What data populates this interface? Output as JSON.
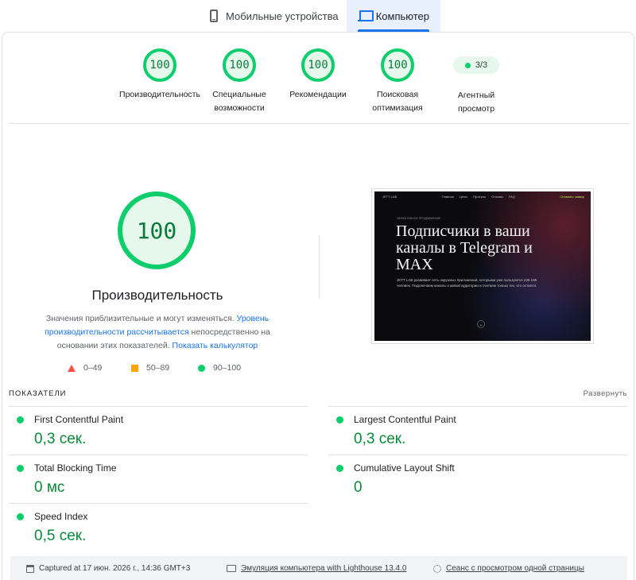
{
  "tabs": [
    {
      "label": "Мобильные устройства",
      "icon": "phone-icon"
    },
    {
      "label": "Компьютер",
      "icon": "laptop-icon",
      "active": true
    }
  ],
  "gauges": [
    {
      "score": "100",
      "label_lines": [
        "Производительность"
      ]
    },
    {
      "score": "100",
      "label_lines": [
        "Специальные",
        "возможности"
      ]
    },
    {
      "score": "100",
      "label_lines": [
        "Рекомендации"
      ]
    },
    {
      "score": "100",
      "label_lines": [
        "Поисковая",
        "оптимизация"
      ]
    }
  ],
  "agent": {
    "value": "3/3",
    "label_lines": [
      "Агентный",
      "просмотр"
    ]
  },
  "main": {
    "score": "100",
    "title": "Производительность",
    "desc_prefix": "Значения приблизительные и могут изменяться. ",
    "desc_link1": "Уровень производительности рассчитывается",
    "desc_middle": " непосредственно на основании этих показателей. ",
    "desc_link2": "Показать калькулятор"
  },
  "legend": [
    {
      "range": "0–49",
      "shape": "triangle",
      "color": "#ff4e42"
    },
    {
      "range": "50–89",
      "shape": "square",
      "color": "#ffa400"
    },
    {
      "range": "90–100",
      "shape": "circle",
      "color": "#0cce6b"
    }
  ],
  "screenshot": {
    "brand": "JETT LAB",
    "nav_links": [
      "Главная",
      "Цены",
      "Проекты",
      "Отзывы",
      "FAQ"
    ],
    "cta": "Оставить заявку",
    "kicker": "ЭФФЕКТИВНОЕ ПРОДВИЖЕНИЕ",
    "headline": "Подписчики в ваши каналы в Telegram и MAX",
    "body": "JETT LAB развивает сеть окружных приложений, которыми уже пользуются 235 195 человек. Подключаем каналы к живой аудитории и считаем только тех, кто остался."
  },
  "metrics": {
    "heading": "ПОКАЗАТЕЛИ",
    "expand": "Развернуть",
    "items": [
      {
        "name": "First Contentful Paint",
        "value": "0,3 сек."
      },
      {
        "name": "Largest Contentful Paint",
        "value": "0,3 сек."
      },
      {
        "name": "Total Blocking Time",
        "value": "0 мс"
      },
      {
        "name": "Cumulative Layout Shift",
        "value": "0"
      },
      {
        "name": "Speed Index",
        "value": "0,5 сек."
      }
    ]
  },
  "footer": {
    "captured": "Captured at 17 июн. 2026 г., 14:36 GMT+3",
    "emulation": "Эмуляция компьютера with Lighthouse 13.4.0",
    "session": "Сеанс с просмотром одной страницы"
  },
  "colors": {
    "pass": "#0cce6b",
    "pass_text": "#0a8a3a",
    "accent": "#1a73e8",
    "average": "#ffa400",
    "fail": "#ff4e42"
  }
}
